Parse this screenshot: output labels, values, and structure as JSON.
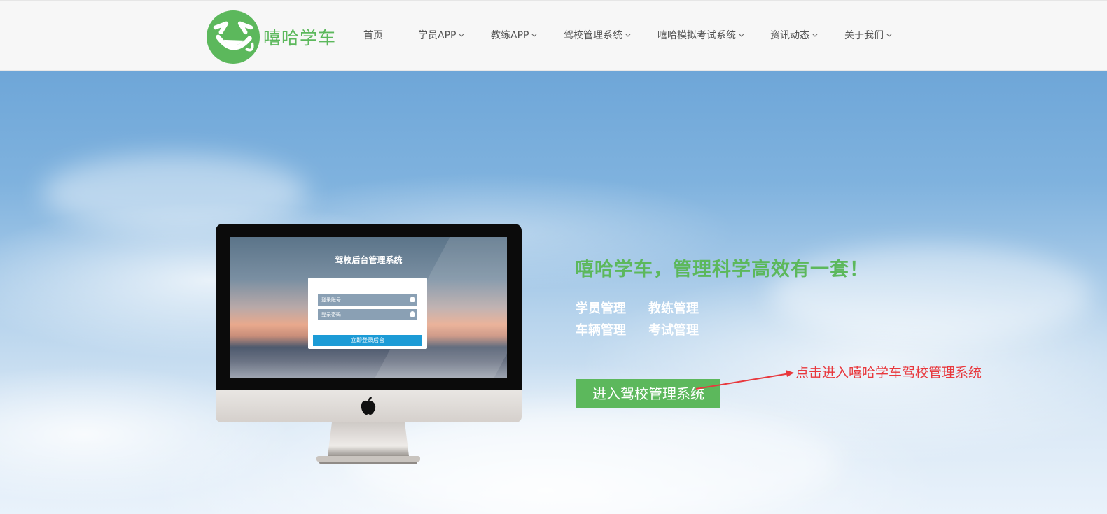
{
  "brand": {
    "name": "嘻哈学车",
    "color": "#5cb85c"
  },
  "nav": {
    "items": [
      {
        "label": "首页",
        "dropdown": false
      },
      {
        "label": "学员APP",
        "dropdown": true
      },
      {
        "label": "教练APP",
        "dropdown": true
      },
      {
        "label": "驾校管理系统",
        "dropdown": true
      },
      {
        "label": "嘻哈模拟考试系统",
        "dropdown": true
      },
      {
        "label": "资讯动态",
        "dropdown": true
      },
      {
        "label": "关于我们",
        "dropdown": true
      }
    ]
  },
  "hero": {
    "screen": {
      "title": "驾校后台管理系统",
      "account_placeholder": "登录账号",
      "password_placeholder": "登录密码",
      "login_button": "立即登录后台"
    },
    "tagline": "嘻哈学车，管理科学高效有一套！",
    "features": [
      "学员管理",
      "教练管理",
      "车辆管理",
      "考试管理"
    ],
    "cta_label": "进入驾校管理系统",
    "annotation": "点击进入嘻哈学车驾校管理系统",
    "annotation_color": "#e8383d",
    "cta_color": "#5cb85c"
  }
}
